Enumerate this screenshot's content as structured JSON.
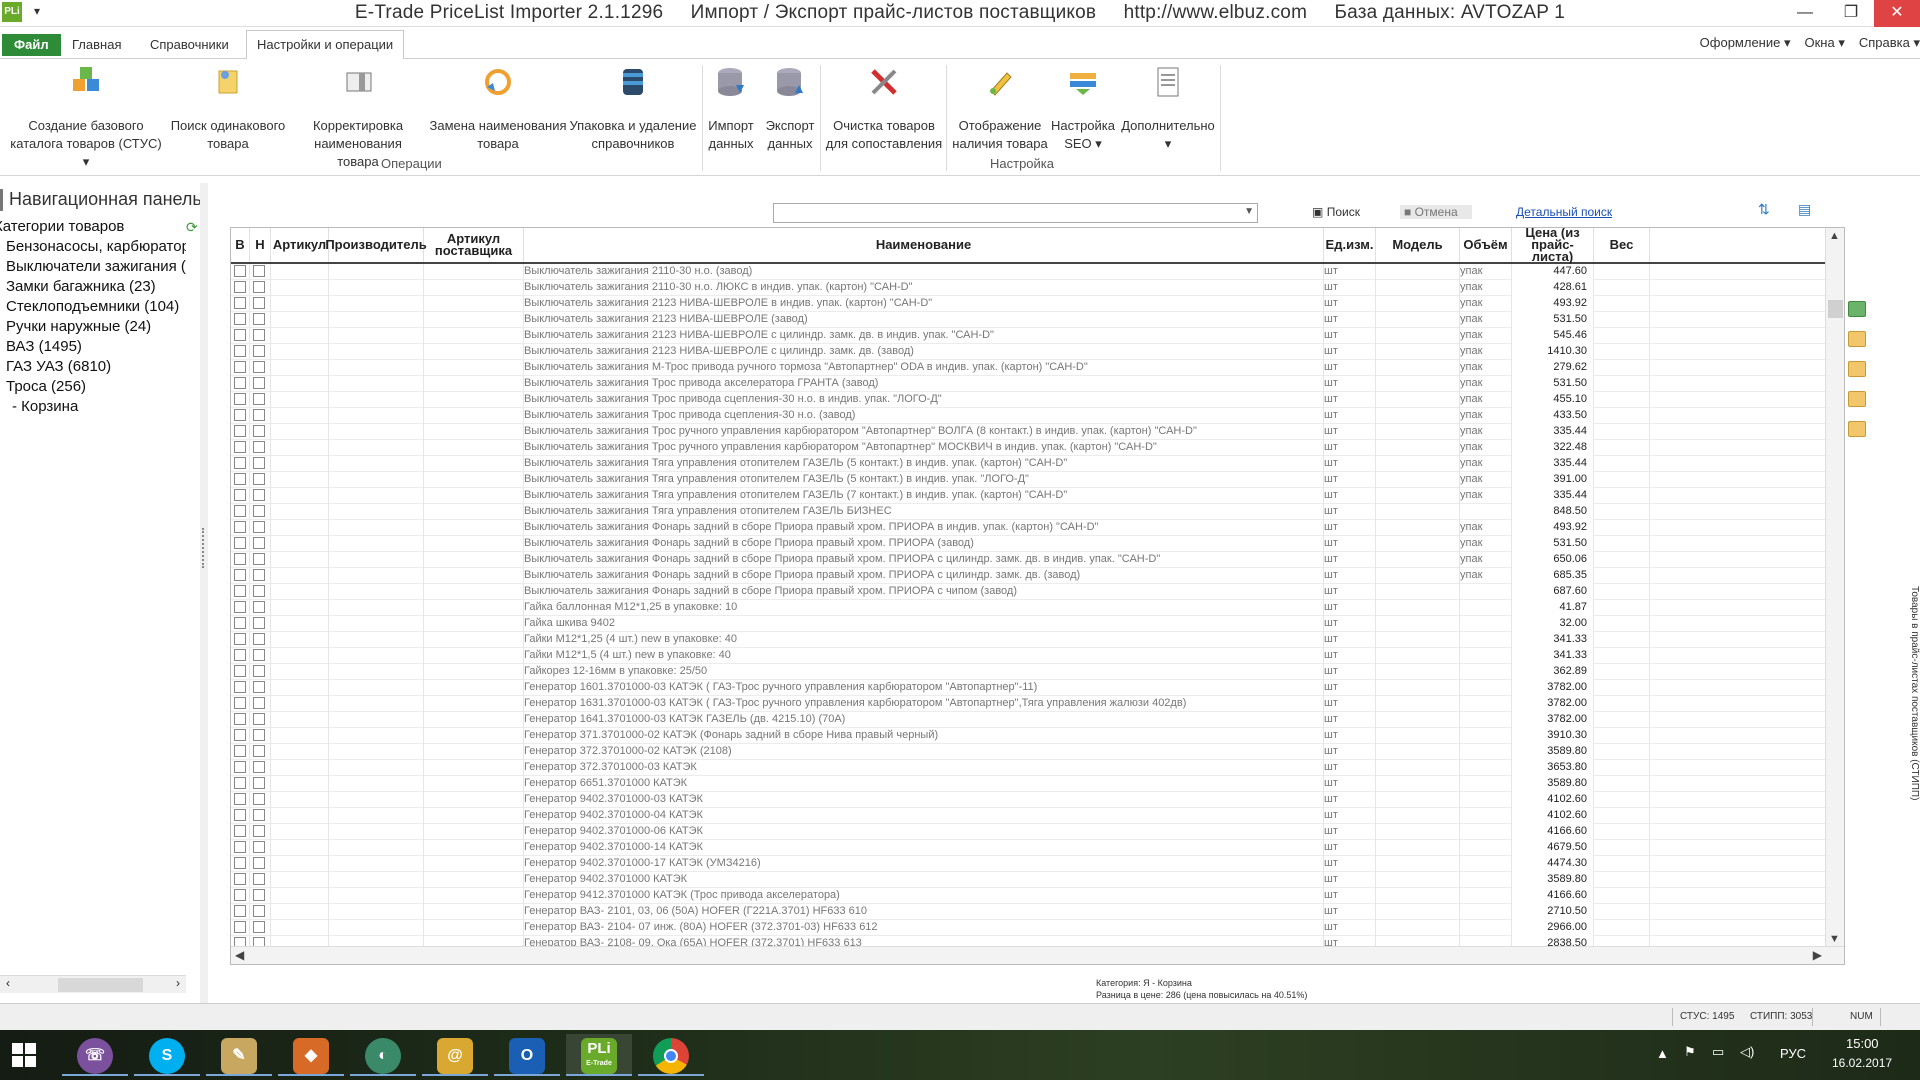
{
  "window": {
    "title": "E-Trade PriceList Importer 2.1.1296     Импорт / Экспорт прайс-листов поставщиков     http://www.elbuz.com     База данных: AVTOZAP 1",
    "logo": "PLi",
    "qa_dropdown": "▾",
    "min": "—",
    "max": "❐",
    "close": "✕"
  },
  "tabs": {
    "file": "Файл",
    "home": "Главная",
    "refs": "Справочники",
    "settings_ops": "Настройки и операции"
  },
  "right_menu": {
    "design": "Оформление ▾",
    "window": "Окна ▾",
    "help": "Справка ▾"
  },
  "ribbon": {
    "create_catalog": [
      "Создание базового",
      "каталога товаров (СТУС) ▾"
    ],
    "find_same": [
      "Поиск одинакового",
      "товара"
    ],
    "correct_name": [
      "Корректировка",
      "наименования товара"
    ],
    "replace_name": [
      "Замена наименования",
      "товара"
    ],
    "pack_delete": [
      "Упаковка и удаление",
      "справочников"
    ],
    "import": [
      "Импорт",
      "данных"
    ],
    "export": [
      "Экспорт",
      "данных"
    ],
    "cleanup": [
      "Очистка товаров",
      "для сопоставления"
    ],
    "show_avail": [
      "Отображение",
      "наличия товара"
    ],
    "seo": [
      "Настройка",
      "SEO ▾"
    ],
    "extra": [
      "Дополнительно",
      "▾"
    ],
    "group_ops": "Операции",
    "group_settings": "Настройка"
  },
  "nav": {
    "title": "Навигационная панель",
    "items": [
      "Категории товаров",
      "Бензонасосы, карбюраторы",
      "Выключатели зажигания (",
      "Замки багажника (23)",
      "Стеклоподъемники (104)",
      "Ручки наружные (24)",
      "ВАЗ (1495)",
      "ГАЗ УАЗ (6810)",
      "Троса (256)",
      "- Корзина"
    ]
  },
  "search": {
    "value": "",
    "find": "Поиск",
    "cancel": "Отмена",
    "advanced": "Детальный поиск"
  },
  "grid": {
    "columns": [
      "В",
      "Н",
      "Артикул",
      "Производитель",
      "Артикул поставщика",
      "Наименование",
      "Ед.изм.",
      "Модель",
      "Объём",
      "Цена (из прайс-листа)",
      "Вес"
    ],
    "rows": [
      {
        "name": "Выключатель зажигания 2110-30 н.о. (завод)",
        "unit": "шт",
        "vol": "упак",
        "price": "447.60"
      },
      {
        "name": "Выключатель зажигания 2110-30 н.о. ЛЮКС в индив. упак. (картон) \"САН-D\"",
        "unit": "шт",
        "vol": "упак",
        "price": "428.61"
      },
      {
        "name": "Выключатель зажигания 2123 НИВА-ШЕВРОЛЕ в индив. упак. (картон) \"САН-D\"",
        "unit": "шт",
        "vol": "упак",
        "price": "493.92"
      },
      {
        "name": "Выключатель зажигания 2123 НИВА-ШЕВРОЛЕ (завод)",
        "unit": "шт",
        "vol": "упак",
        "price": "531.50"
      },
      {
        "name": "Выключатель зажигания 2123 НИВА-ШЕВРОЛЕ с цилиндр. замк. дв. в индив. упак. \"САН-D\"",
        "unit": "шт",
        "vol": "упак",
        "price": "545.46"
      },
      {
        "name": "Выключатель зажигания 2123 НИВА-ШЕВРОЛЕ с цилиндр. замк. дв. (завод)",
        "unit": "шт",
        "vol": "упак",
        "price": "1410.30"
      },
      {
        "name": "Выключатель зажигания М-Трос привода ручного тормоза  \"Автопартнер\" ODA в индив. упак. (картон) \"САН-D\"",
        "unit": "шт",
        "vol": "упак",
        "price": "279.62"
      },
      {
        "name": "Выключатель зажигания Трос привода акселератора ГРАНТА (завод)",
        "unit": "шт",
        "vol": "упак",
        "price": "531.50"
      },
      {
        "name": "Выключатель зажигания Трос привода сцепления-30 н.о. в индив. упак. \"ЛОГО-Д\"",
        "unit": "шт",
        "vol": "упак",
        "price": "455.10"
      },
      {
        "name": "Выключатель зажигания Трос привода сцепления-30 н.о. (завод)",
        "unit": "шт",
        "vol": "упак",
        "price": "433.50"
      },
      {
        "name": "Выключатель зажигания Трос ручного управления карбюратором \"Автопартнер\" ВОЛГА (8 контакт.) в индив. упак. (картон) \"САН-D\"",
        "unit": "шт",
        "vol": "упак",
        "price": "335.44"
      },
      {
        "name": "Выключатель зажигания Трос ручного управления карбюратором \"Автопартнер\" МОСКВИЧ в индив. упак. (картон) \"САН-D\"",
        "unit": "шт",
        "vol": "упак",
        "price": "322.48"
      },
      {
        "name": "Выключатель зажигания Тяга управления отопителем ГАЗЕЛЬ (5 контакт.) в индив. упак. (картон) \"САН-D\"",
        "unit": "шт",
        "vol": "упак",
        "price": "335.44"
      },
      {
        "name": "Выключатель зажигания Тяга управления отопителем ГАЗЕЛЬ (5 контакт.) в индив. упак. \"ЛОГО-Д\"",
        "unit": "шт",
        "vol": "упак",
        "price": "391.00"
      },
      {
        "name": "Выключатель зажигания Тяга управления отопителем ГАЗЕЛЬ (7 контакт.) в индив. упак. (картон) \"САН-D\"",
        "unit": "шт",
        "vol": "упак",
        "price": "335.44"
      },
      {
        "name": "Выключатель зажигания Тяга управления отопителем ГАЗЕЛЬ БИЗНЕС",
        "unit": "шт",
        "vol": "",
        "price": "848.50"
      },
      {
        "name": "Выключатель зажигания Фонарь задний в сборе Приора правый  хром. ПРИОРА в индив. упак. (картон) \"САН-D\"",
        "unit": "шт",
        "vol": "упак",
        "price": "493.92"
      },
      {
        "name": "Выключатель зажигания Фонарь задний в сборе Приора правый  хром. ПРИОРА (завод)",
        "unit": "шт",
        "vol": "упак",
        "price": "531.50"
      },
      {
        "name": "Выключатель зажигания Фонарь задний в сборе Приора правый  хром. ПРИОРА с цилиндр. замк. дв. в индив. упак. \"САН-D\"",
        "unit": "шт",
        "vol": "упак",
        "price": "650.06"
      },
      {
        "name": "Выключатель зажигания Фонарь задний в сборе Приора правый  хром. ПРИОРА с цилиндр. замк. дв. (завод)",
        "unit": "шт",
        "vol": "упак",
        "price": "685.35"
      },
      {
        "name": "Выключатель зажигания Фонарь задний в сборе Приора правый  хром. ПРИОРА с чипом (завод)",
        "unit": "шт",
        "vol": "",
        "price": "687.60"
      },
      {
        "name": "Гайка баллонная М12*1,25 в упаковке: 10",
        "unit": "шт",
        "vol": "",
        "price": "41.87"
      },
      {
        "name": "Гайка шкива 9402",
        "unit": "шт",
        "vol": "",
        "price": "32.00"
      },
      {
        "name": "Гайки М12*1,25 (4 шт.) new в упаковке: 40",
        "unit": "шт",
        "vol": "",
        "price": "341.33"
      },
      {
        "name": "Гайки М12*1,5 (4 шт.) new в упаковке: 40",
        "unit": "шт",
        "vol": "",
        "price": "341.33"
      },
      {
        "name": "Гайкорез 12-16мм в упаковке: 25/50",
        "unit": "шт",
        "vol": "",
        "price": "362.89"
      },
      {
        "name": "Генератор 1601.3701000-03 КАТЭК  ( ГАЗ-Трос ручного управления карбюратором \"Автопартнер\"-11)",
        "unit": "шт",
        "vol": "",
        "price": "3782.00"
      },
      {
        "name": "Генератор 1631.3701000-03 КАТЭК  ( ГАЗ-Трос ручного управления карбюратором \"Автопартнер\",Тяга управления жалюзи 402дв)",
        "unit": "шт",
        "vol": "",
        "price": "3782.00"
      },
      {
        "name": "Генератор 1641.3701000-03 КАТЭК  ГАЗЕЛЬ (дв. 4215.10) (70А)",
        "unit": "шт",
        "vol": "",
        "price": "3782.00"
      },
      {
        "name": "Генератор 371.3701000-02 КАТЭК (Фонарь задний в сборе Нива  правый черный)",
        "unit": "шт",
        "vol": "",
        "price": "3910.30"
      },
      {
        "name": "Генератор 372.3701000-02 КАТЭК  (2108)",
        "unit": "шт",
        "vol": "",
        "price": "3589.80"
      },
      {
        "name": "Генератор 372.3701000-03 КАТЭК",
        "unit": "шт",
        "vol": "",
        "price": "3653.80"
      },
      {
        "name": "Генератор 6651.3701000 КАТЭК",
        "unit": "шт",
        "vol": "",
        "price": "3589.80"
      },
      {
        "name": "Генератор 9402.3701000-03 КАТЭК",
        "unit": "шт",
        "vol": "",
        "price": "4102.60"
      },
      {
        "name": "Генератор 9402.3701000-04 КАТЭК",
        "unit": "шт",
        "vol": "",
        "price": "4102.60"
      },
      {
        "name": "Генератор 9402.3701000-06 КАТЭК",
        "unit": "шт",
        "vol": "",
        "price": "4166.60"
      },
      {
        "name": "Генератор 9402.3701000-14 КАТЭК",
        "unit": "шт",
        "vol": "",
        "price": "4679.50"
      },
      {
        "name": "Генератор 9402.3701000-17 КАТЭК (УМЗ4216)",
        "unit": "шт",
        "vol": "",
        "price": "4474.30"
      },
      {
        "name": "Генератор 9402.3701000 КАТЭК",
        "unit": "шт",
        "vol": "",
        "price": "3589.80"
      },
      {
        "name": "Генератор 9412.3701000 КАТЭК (Трос привода акселератора)",
        "unit": "шт",
        "vol": "",
        "price": "4166.60"
      },
      {
        "name": "Генератор ВАЗ- 2101, 03, 06 (50А) HOFER (Г221А.3701) HF633 610",
        "unit": "шт",
        "vol": "",
        "price": "2710.50"
      },
      {
        "name": "Генератор ВАЗ- 2104- 07 инж. (80А) HOFER (372.3701-03) HF633 612",
        "unit": "шт",
        "vol": "",
        "price": "2966.00"
      },
      {
        "name": "Генератор ВАЗ- 2108- 09, Ока (65А) HOFER (372.3701) HF633 613",
        "unit": "шт",
        "vol": "",
        "price": "2838.50"
      }
    ]
  },
  "side_vertical_tab": "Товары в прайс-листах поставщиков (СТИПП)",
  "status_info": {
    "line1": "Категория: Я - Корзина",
    "line2": "Разница в цене: 286  (цена повысилась на 40.51%)"
  },
  "statusbar": {
    "stus": "СТУС: 1495",
    "stipp": "СТИПП: 3053",
    "num": "NUM"
  },
  "taskbar": {
    "apps": [
      "Viber",
      "Skype",
      "Docs",
      "Fox",
      "App",
      "Mail",
      "Outlook",
      "PLi",
      "Chrome"
    ],
    "lang": "РУС",
    "time": "15:00",
    "date": "16.02.2017",
    "pli_label": "PLi",
    "pli_sub": "E-Trade"
  },
  "colors": {
    "file_tab": "#2e8b38",
    "close_btn": "#e04343",
    "link": "#1a4fb3"
  }
}
